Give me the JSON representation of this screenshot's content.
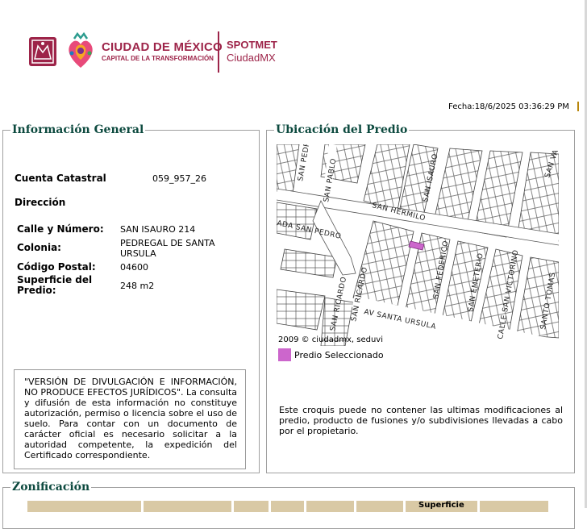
{
  "header": {
    "city_name": "CIUDAD DE MÉXICO",
    "city_tagline": "CAPITAL DE LA TRANSFORMACIÓN",
    "app_title": "SPOTMET",
    "app_subtitle": "CiudadMX",
    "brand_color": "#9d2449"
  },
  "date_label": "Fecha:18/6/2025 03:36:29 PM",
  "info": {
    "legend": "Información General",
    "cuenta_label": "Cuenta Catastral",
    "cuenta_value": "059_957_26",
    "direccion_label": "Dirección",
    "calle_label": "Calle y Número:",
    "calle_value": "SAN ISAURO 214",
    "colonia_label": "Colonia:",
    "colonia_value": "PEDREGAL DE SANTA URSULA",
    "cp_label": "Código Postal:",
    "cp_value": "04600",
    "superficie_label": "Superficie del Predio:",
    "superficie_value": "248 m2",
    "disclaimer": "\"VERSIÓN DE DIVULGACIÓN E INFORMACIÓN, NO PRODUCE EFECTOS JURÍDICOS\". La consulta y difusión de esta información no constituye autorización, permiso o licencia sobre el uso de suelo. Para contar con un documento de carácter oficial es necesario solicitar a la autoridad competente, la expedición del Certificado correspondiente."
  },
  "ubicacion": {
    "legend": "Ubicación del Predio",
    "map_caption": "2009 © ciudadmx, seduvi",
    "legend_label": "Predio Seleccionado",
    "legend_color": "#cc66cc",
    "note": "Este croquis puede no contener las ultimas modificaciones al predio, producto de fusiones y/o subdivisiones llevadas a cabo por el propietario.",
    "streets": [
      "SAN PEDRO",
      "SAN PABLO",
      "SAN HERMILO",
      "SAN ISAURO",
      "SAN VA",
      "ADA SAN PEDRO",
      "SAN RICARDO",
      "SAN RICARDO",
      "SAN FEDERICO",
      "SAN EMETERIO",
      "CALLE SAN VICTORINO",
      "SANTO TOMAS",
      "AV SANTA URSULA"
    ]
  },
  "zonificacion": {
    "legend": "Zonificación",
    "col_superficie": "Superficie"
  }
}
